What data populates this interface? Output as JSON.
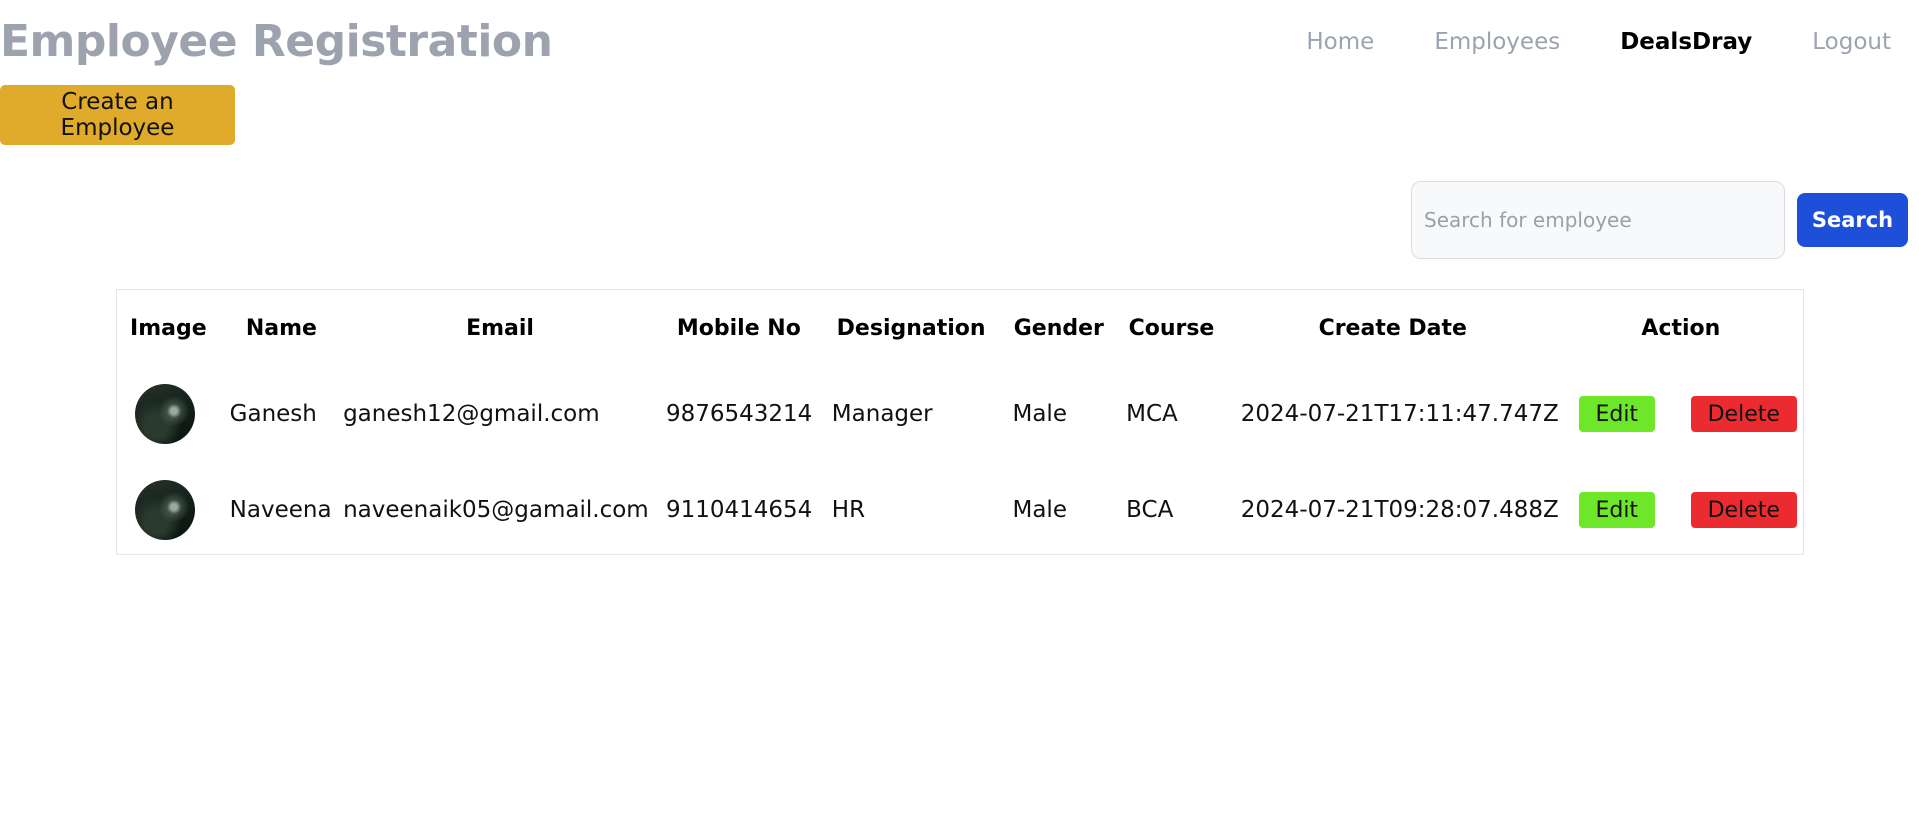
{
  "header": {
    "title": "Employee Registration",
    "nav": [
      {
        "label": "Home"
      },
      {
        "label": "Employees"
      },
      {
        "label": "DealsDray"
      },
      {
        "label": "Logout"
      }
    ]
  },
  "toolbar": {
    "create_label": "Create an Employee"
  },
  "search": {
    "placeholder": "Search for employee",
    "value": "",
    "button_label": "Search"
  },
  "table": {
    "columns": [
      "Image",
      "Name",
      "Email",
      "Mobile No",
      "Designation",
      "Gender",
      "Course",
      "Create Date",
      "Action"
    ],
    "rows": [
      {
        "image": "avatar-forest-photo",
        "name": "Ganesh",
        "email": "ganesh12@gmail.com",
        "mobile": "9876543214",
        "designation": "Manager",
        "gender": "Male",
        "course": "MCA",
        "create_date": "2024-07-21T17:11:47.747Z",
        "edit_label": "Edit",
        "delete_label": "Delete"
      },
      {
        "image": "avatar-forest-photo",
        "name": "Naveena",
        "email": "naveenaik05@gamail.com",
        "mobile": "9110414654",
        "designation": "HR",
        "gender": "Male",
        "course": "BCA",
        "create_date": "2024-07-21T09:28:07.488Z",
        "edit_label": "Edit",
        "delete_label": "Delete"
      }
    ]
  },
  "colors": {
    "title": "#9ca3af",
    "create_button": "#e0aa2a",
    "search_button": "#1e4fd8",
    "edit_button": "#6ee72a",
    "delete_button": "#ec2b30"
  }
}
